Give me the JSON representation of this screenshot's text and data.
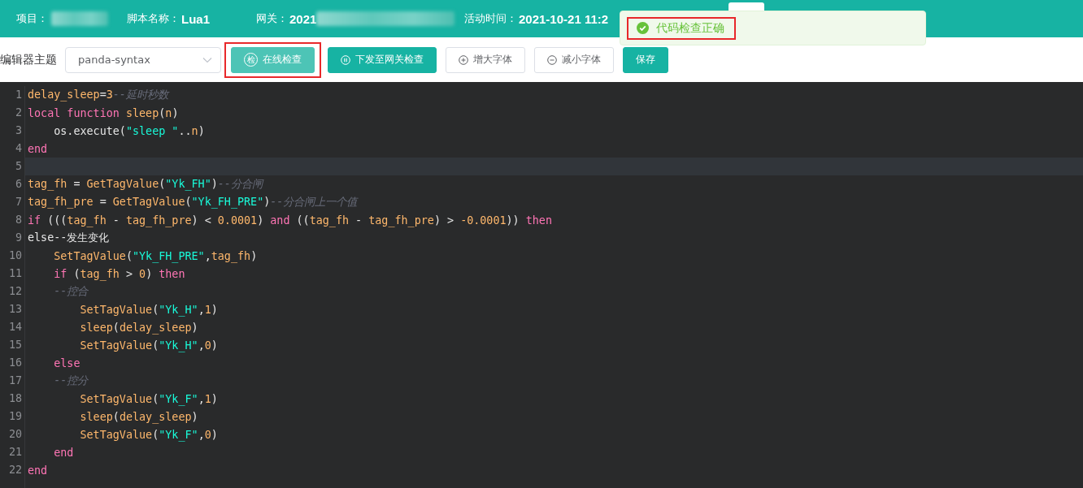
{
  "header": {
    "fields": [
      {
        "label": "项目：",
        "redacted": true
      },
      {
        "label": "脚本名称：",
        "value": "Lua1"
      },
      {
        "label": "网关：",
        "value": "2021",
        "redacted": true
      },
      {
        "label": "活动时间：",
        "value": "2021-10-21 11:2"
      }
    ]
  },
  "toast": {
    "kind": "success",
    "message": "代码检查正确",
    "annotated": true
  },
  "toolbar": {
    "theme_label": "编辑器主题",
    "theme_value": "panda-syntax",
    "buttons": [
      {
        "label": "在线检查",
        "kind": "primary",
        "icon_text": "检",
        "focused": true,
        "annotated": true
      },
      {
        "label": "下发至网关检查",
        "kind": "primary",
        "focused": false,
        "annotated": false
      },
      {
        "label": "增大字体",
        "kind": "default",
        "focused": false,
        "annotated": false
      },
      {
        "label": "减小字体",
        "kind": "default",
        "focused": false,
        "annotated": false
      },
      {
        "label": "保存",
        "kind": "primary",
        "focused": false,
        "annotated": false
      }
    ]
  },
  "editor": {
    "lines": [
      {
        "number": "1",
        "active": false,
        "tokens": [
          {
            "kind": "var",
            "text": "delay_sleep"
          },
          {
            "kind": "plain",
            "text": "="
          },
          {
            "kind": "num",
            "text": "3"
          },
          {
            "kind": "comment",
            "text": "--延时秒数"
          }
        ]
      },
      {
        "number": "2",
        "active": false,
        "tokens": [
          {
            "kind": "kw",
            "text": "local function"
          },
          {
            "kind": "var",
            "text": " sleep"
          },
          {
            "kind": "plain",
            "text": "("
          },
          {
            "kind": "var",
            "text": "n"
          },
          {
            "kind": "plain",
            "text": ")"
          }
        ]
      },
      {
        "number": "3",
        "active": false,
        "tokens": [
          {
            "kind": "plain",
            "text": "    os.execute("
          },
          {
            "kind": "str",
            "text": "\"sleep \""
          },
          {
            "kind": "plain",
            "text": ".."
          },
          {
            "kind": "var",
            "text": "n"
          },
          {
            "kind": "plain",
            "text": ")"
          }
        ]
      },
      {
        "number": "4",
        "active": false,
        "tokens": [
          {
            "kind": "kw",
            "text": "end"
          }
        ]
      },
      {
        "number": "5",
        "active": true
      },
      {
        "number": "6",
        "active": false,
        "tokens": [
          {
            "kind": "var",
            "text": "tag_fh"
          },
          {
            "kind": "plain",
            "text": " = "
          },
          {
            "kind": "var",
            "text": "GetTagValue"
          },
          {
            "kind": "plain",
            "text": "("
          },
          {
            "kind": "str",
            "text": "\"Yk_FH\""
          },
          {
            "kind": "plain",
            "text": ")"
          },
          {
            "kind": "comment",
            "text": "--分合闸"
          }
        ]
      },
      {
        "number": "7",
        "active": false,
        "tokens": [
          {
            "kind": "var",
            "text": "tag_fh_pre"
          },
          {
            "kind": "plain",
            "text": " = "
          },
          {
            "kind": "var",
            "text": "GetTagValue"
          },
          {
            "kind": "plain",
            "text": "("
          },
          {
            "kind": "str",
            "text": "\"Yk_FH_PRE\""
          },
          {
            "kind": "plain",
            "text": ")"
          },
          {
            "kind": "comment",
            "text": "--分合闸上一个值"
          }
        ]
      },
      {
        "number": "8",
        "active": false,
        "tokens": [
          {
            "kind": "kw",
            "text": "if"
          },
          {
            "kind": "plain",
            "text": " ((("
          },
          {
            "kind": "var",
            "text": "tag_fh"
          },
          {
            "kind": "plain",
            "text": " - "
          },
          {
            "kind": "var",
            "text": "tag_fh_pre"
          },
          {
            "kind": "plain",
            "text": ") < "
          },
          {
            "kind": "num",
            "text": "0.0001"
          },
          {
            "kind": "plain",
            "text": ") "
          },
          {
            "kind": "kw",
            "text": "and"
          },
          {
            "kind": "plain",
            "text": " (("
          },
          {
            "kind": "var",
            "text": "tag_fh"
          },
          {
            "kind": "plain",
            "text": " - "
          },
          {
            "kind": "var",
            "text": "tag_fh_pre"
          },
          {
            "kind": "plain",
            "text": ") > "
          },
          {
            "kind": "num",
            "text": "-0.0001"
          },
          {
            "kind": "plain",
            "text": ")) "
          },
          {
            "kind": "kw",
            "text": "then"
          }
        ]
      },
      {
        "number": "9",
        "active": false,
        "tokens": [
          {
            "kind": "plain",
            "text": "else--发生变化"
          }
        ]
      },
      {
        "number": "10",
        "active": false,
        "tokens": [
          {
            "kind": "var",
            "text": "    SetTagValue"
          },
          {
            "kind": "plain",
            "text": "("
          },
          {
            "kind": "str",
            "text": "\"Yk_FH_PRE\""
          },
          {
            "kind": "plain",
            "text": ","
          },
          {
            "kind": "var",
            "text": "tag_fh"
          },
          {
            "kind": "plain",
            "text": ")"
          }
        ]
      },
      {
        "number": "11",
        "active": false,
        "tokens": [
          {
            "kind": "kw",
            "text": "    if"
          },
          {
            "kind": "plain",
            "text": " ("
          },
          {
            "kind": "var",
            "text": "tag_fh"
          },
          {
            "kind": "plain",
            "text": " > "
          },
          {
            "kind": "num",
            "text": "0"
          },
          {
            "kind": "plain",
            "text": ") "
          },
          {
            "kind": "kw",
            "text": "then"
          }
        ]
      },
      {
        "number": "12",
        "active": false,
        "tokens": [
          {
            "kind": "comment",
            "text": "    --控合"
          }
        ]
      },
      {
        "number": "13",
        "active": false,
        "tokens": [
          {
            "kind": "var",
            "text": "        SetTagValue"
          },
          {
            "kind": "plain",
            "text": "("
          },
          {
            "kind": "str",
            "text": "\"Yk_H\""
          },
          {
            "kind": "plain",
            "text": ","
          },
          {
            "kind": "num",
            "text": "1"
          },
          {
            "kind": "plain",
            "text": ")"
          }
        ]
      },
      {
        "number": "14",
        "active": false,
        "tokens": [
          {
            "kind": "var",
            "text": "        sleep"
          },
          {
            "kind": "plain",
            "text": "("
          },
          {
            "kind": "var",
            "text": "delay_sleep"
          },
          {
            "kind": "plain",
            "text": ")"
          }
        ]
      },
      {
        "number": "15",
        "active": false,
        "tokens": [
          {
            "kind": "var",
            "text": "        SetTagValue"
          },
          {
            "kind": "plain",
            "text": "("
          },
          {
            "kind": "str",
            "text": "\"Yk_H\""
          },
          {
            "kind": "plain",
            "text": ","
          },
          {
            "kind": "num",
            "text": "0"
          },
          {
            "kind": "plain",
            "text": ")"
          }
        ]
      },
      {
        "number": "16",
        "active": false,
        "tokens": [
          {
            "kind": "kw",
            "text": "    else"
          }
        ]
      },
      {
        "number": "17",
        "active": false,
        "tokens": [
          {
            "kind": "comment",
            "text": "    --控分"
          }
        ]
      },
      {
        "number": "18",
        "active": false,
        "tokens": [
          {
            "kind": "var",
            "text": "        SetTagValue"
          },
          {
            "kind": "plain",
            "text": "("
          },
          {
            "kind": "str",
            "text": "\"Yk_F\""
          },
          {
            "kind": "plain",
            "text": ","
          },
          {
            "kind": "num",
            "text": "1"
          },
          {
            "kind": "plain",
            "text": ")"
          }
        ]
      },
      {
        "number": "19",
        "active": false,
        "tokens": [
          {
            "kind": "var",
            "text": "        sleep"
          },
          {
            "kind": "plain",
            "text": "("
          },
          {
            "kind": "var",
            "text": "delay_sleep"
          },
          {
            "kind": "plain",
            "text": ")"
          }
        ]
      },
      {
        "number": "20",
        "active": false,
        "tokens": [
          {
            "kind": "var",
            "text": "        SetTagValue"
          },
          {
            "kind": "plain",
            "text": "("
          },
          {
            "kind": "str",
            "text": "\"Yk_F\""
          },
          {
            "kind": "plain",
            "text": ","
          },
          {
            "kind": "num",
            "text": "0"
          },
          {
            "kind": "plain",
            "text": ")"
          }
        ]
      },
      {
        "number": "21",
        "active": false,
        "tokens": [
          {
            "kind": "kw",
            "text": "    end"
          }
        ]
      },
      {
        "number": "22",
        "active": false,
        "tokens": [
          {
            "kind": "kw",
            "text": "end"
          }
        ]
      }
    ]
  }
}
